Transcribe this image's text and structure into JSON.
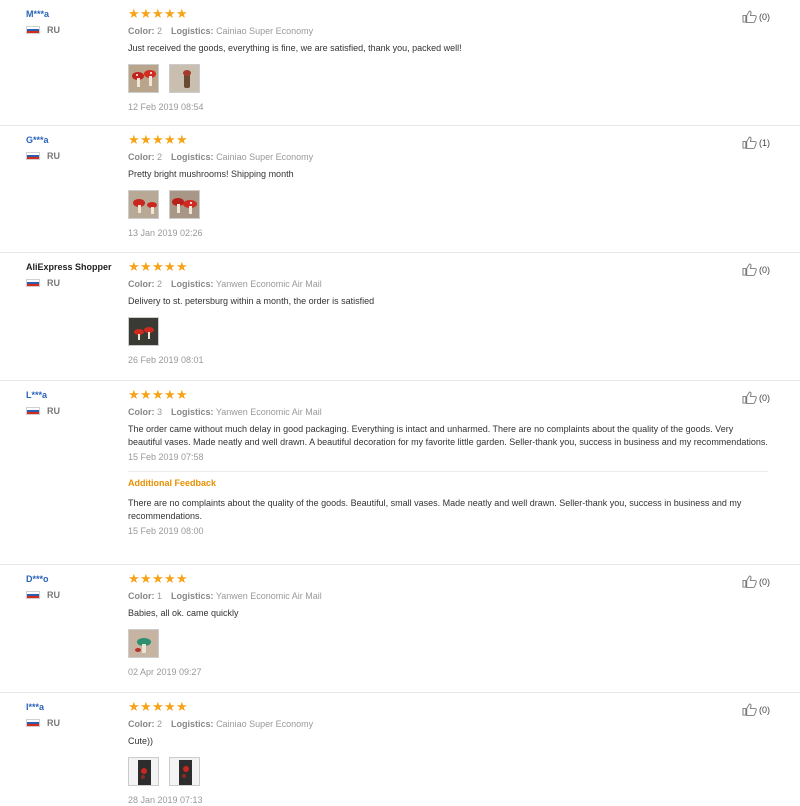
{
  "reviews": [
    {
      "user": "M***a",
      "country": "RU",
      "stars": 5,
      "color_label": "Color:",
      "color_value": "2",
      "logistics_label": "Logistics:",
      "logistics_value": "Cainiao Super Economy",
      "text": "Just received the goods, everything is fine, we are satisfied, thank you, packed well!",
      "images": [
        "mushrooms-photo",
        "mushroom-single-photo"
      ],
      "date": "12 Feb 2019 08:54",
      "helpful": "(0)"
    },
    {
      "user": "G***a",
      "country": "RU",
      "stars": 5,
      "color_label": "Color:",
      "color_value": "2",
      "logistics_label": "Logistics:",
      "logistics_value": "Cainiao Super Economy",
      "text": "Pretty bright mushrooms! Shipping month",
      "images": [
        "mushrooms-photo",
        "mushrooms-photo"
      ],
      "date": "13 Jan 2019 02:26",
      "helpful": "(1)"
    },
    {
      "user": "AliExpress Shopper",
      "country": "RU",
      "stars": 5,
      "color_label": "Color:",
      "color_value": "2",
      "logistics_label": "Logistics:",
      "logistics_value": "Yanwen Economic Air Mail",
      "text": "Delivery to st. petersburg within a month, the order is satisfied",
      "images": [
        "mushrooms-dark-photo"
      ],
      "date": "26 Feb 2019 08:01",
      "helpful": "(0)"
    },
    {
      "user": "L***a",
      "country": "RU",
      "stars": 5,
      "color_label": "Color:",
      "color_value": "3",
      "logistics_label": "Logistics:",
      "logistics_value": "Yanwen Economic Air Mail",
      "text": "The order came without much delay in good packaging. Everything is intact and unharmed. There are no complaints about the quality of the goods. Very beautiful vases. Made neatly and well drawn. A beautiful decoration for my favorite little garden. Seller-thank you, success in business and my recommendations.",
      "images": [],
      "date": "15 Feb 2019 07:58",
      "helpful": "(0)",
      "additional_label": "Additional Feedback",
      "additional_text": "There are no complaints about the quality of the goods. Beautiful, small vases. Made neatly and well drawn. Seller-thank you, success in business and my recommendations.",
      "additional_date": "15 Feb 2019 08:00"
    },
    {
      "user": "D***o",
      "country": "RU",
      "stars": 5,
      "color_label": "Color:",
      "color_value": "1",
      "logistics_label": "Logistics:",
      "logistics_value": "Yanwen Economic Air Mail",
      "text": "Babies, all ok. came quickly",
      "images": [
        "green-mushroom-photo"
      ],
      "date": "02 Apr 2019 09:27",
      "helpful": "(0)"
    },
    {
      "user": "I***a",
      "country": "RU",
      "stars": 5,
      "color_label": "Color:",
      "color_value": "2",
      "logistics_label": "Logistics:",
      "logistics_value": "Cainiao Super Economy",
      "text": "Cute))",
      "images": [
        "vase-dark-photo",
        "vase-dark-photo"
      ],
      "date": "28 Jan 2019 07:13",
      "helpful": "(0)"
    }
  ],
  "colors": {
    "star": "#f7a317",
    "username": "#2a63b8",
    "additional_feedback": "#e69000",
    "muted": "#999999"
  }
}
